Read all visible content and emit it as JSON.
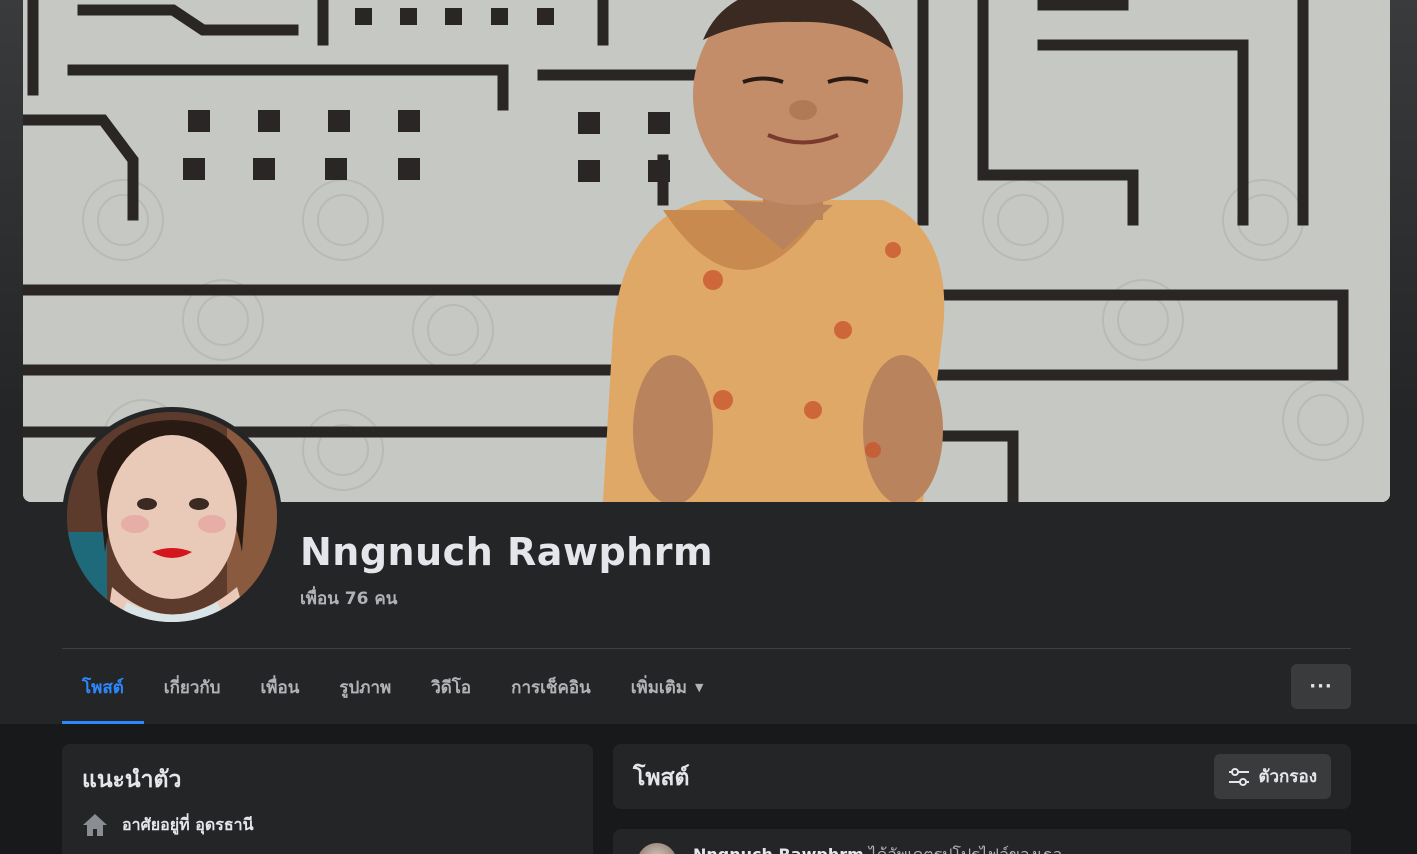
{
  "profile": {
    "name": "Nngnuch Rawphrm",
    "friends": "เพื่อน 76 คน"
  },
  "tabs": [
    {
      "label": "โพสต์",
      "active": true
    },
    {
      "label": "เกี่ยวกับ",
      "active": false
    },
    {
      "label": "เพื่อน",
      "active": false
    },
    {
      "label": "รูปภาพ",
      "active": false
    },
    {
      "label": "วิดีโอ",
      "active": false
    },
    {
      "label": "การเช็คอิน",
      "active": false
    },
    {
      "label": "เพิ่มเติม",
      "active": false
    }
  ],
  "more_button": "···",
  "intro": {
    "title": "แนะนำตัว",
    "lives_in": "อาศัยอยู่ที่ อุดรธานี"
  },
  "posts": {
    "title": "โพสต์",
    "filter_label": "ตัวกรอง"
  },
  "first_post": {
    "author": "Nngnuch Rawphrm",
    "action": " ได้อัพเดตรูปโปรไฟล์ของเธอ"
  },
  "colors": {
    "accent": "#2d88ff",
    "surface": "#242526",
    "background": "#18191a"
  }
}
